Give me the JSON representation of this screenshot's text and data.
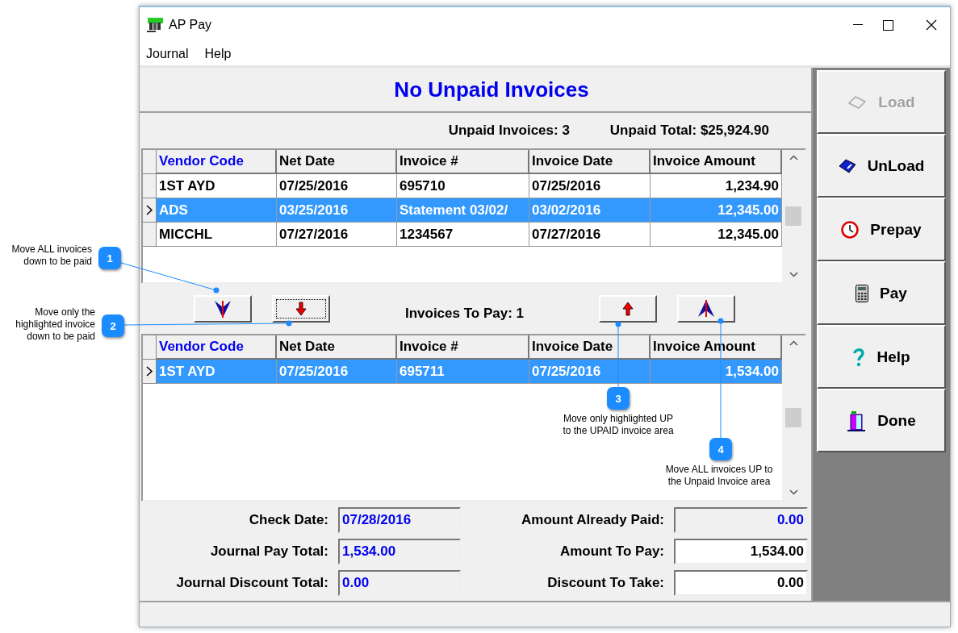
{
  "window": {
    "title": "AP Pay"
  },
  "menu": [
    "Journal",
    "Help"
  ],
  "heading": "No Unpaid Invoices",
  "unpaid_summary": {
    "count": "Unpaid Invoices: 3",
    "total": "Unpaid Total: $25,924.90"
  },
  "unpaid_table": {
    "columns": [
      {
        "label": "Vendor Code",
        "sorted": true,
        "kind": "text"
      },
      {
        "label": "Net Date",
        "sorted": false,
        "kind": "text"
      },
      {
        "label": "Invoice #",
        "sorted": false,
        "kind": "text"
      },
      {
        "label": "Invoice Date",
        "sorted": false,
        "kind": "text"
      },
      {
        "label": "Invoice Amount",
        "sorted": false,
        "kind": "amount"
      }
    ],
    "rows": [
      {
        "cells": [
          "1ST AYD",
          "07/25/2016",
          "695710",
          "07/25/2016",
          "1,234.90"
        ],
        "selected": false
      },
      {
        "cells": [
          "ADS",
          "03/25/2016",
          "Statement 03/02/",
          "03/02/2016",
          "12,345.00"
        ],
        "selected": true
      },
      {
        "cells": [
          "MICCHL",
          "07/27/2016",
          "1234567",
          "07/27/2016",
          "12,345.00"
        ],
        "selected": false
      }
    ]
  },
  "transfer_buttons": [
    {
      "kind": "down-all",
      "focused": false
    },
    {
      "kind": "down-one",
      "focused": true
    }
  ],
  "to_pay_label": "Invoices To Pay: 1",
  "transfer_buttons_up": [
    {
      "kind": "up-one",
      "focused": false
    },
    {
      "kind": "up-all",
      "focused": false
    }
  ],
  "to_pay_table": {
    "columns": [
      {
        "label": "Vendor Code",
        "sorted": true,
        "kind": "text"
      },
      {
        "label": "Net Date",
        "sorted": false,
        "kind": "text"
      },
      {
        "label": "Invoice #",
        "sorted": false,
        "kind": "text"
      },
      {
        "label": "Invoice Date",
        "sorted": false,
        "kind": "text"
      },
      {
        "label": "Invoice Amount",
        "sorted": false,
        "kind": "amount"
      }
    ],
    "rows": [
      {
        "cells": [
          "1ST AYD",
          "07/25/2016",
          "695711",
          "07/25/2016",
          "1,534.00"
        ],
        "selected": true
      }
    ]
  },
  "fields": [
    {
      "label": "Check Date:",
      "value": "07/28/2016",
      "editable": false
    },
    {
      "label": "Amount Already Paid:",
      "value": "0.00",
      "editable": false
    },
    {
      "label": "Journal Pay Total:",
      "value": "1,534.00",
      "editable": false
    },
    {
      "label": "Amount To Pay:",
      "value": "1,534.00",
      "editable": true
    },
    {
      "label": "Journal Discount Total:",
      "value": "0.00",
      "editable": false
    },
    {
      "label": "Discount To Take:",
      "value": "0.00",
      "editable": true
    }
  ],
  "actions": [
    {
      "label": "Load",
      "kind": "load",
      "disabled": true
    },
    {
      "label": "UnLoad",
      "kind": "unload",
      "disabled": false
    },
    {
      "label": "Prepay",
      "kind": "prepay",
      "disabled": false
    },
    {
      "label": "Pay",
      "kind": "pay",
      "disabled": false
    },
    {
      "label": "Help",
      "kind": "help",
      "disabled": false
    },
    {
      "label": "Done",
      "kind": "done",
      "disabled": false
    }
  ],
  "callouts": [
    {
      "number": "1",
      "text": "Move ALL invoices down to be paid"
    },
    {
      "number": "2",
      "text": "Move only the highlighted invoice down to be paid"
    },
    {
      "number": "3",
      "text": "Move only highlighted UP to the UPAID invoice area"
    },
    {
      "number": "4",
      "text": "Move ALL invoices UP to the Unpaid Invoice area"
    }
  ]
}
